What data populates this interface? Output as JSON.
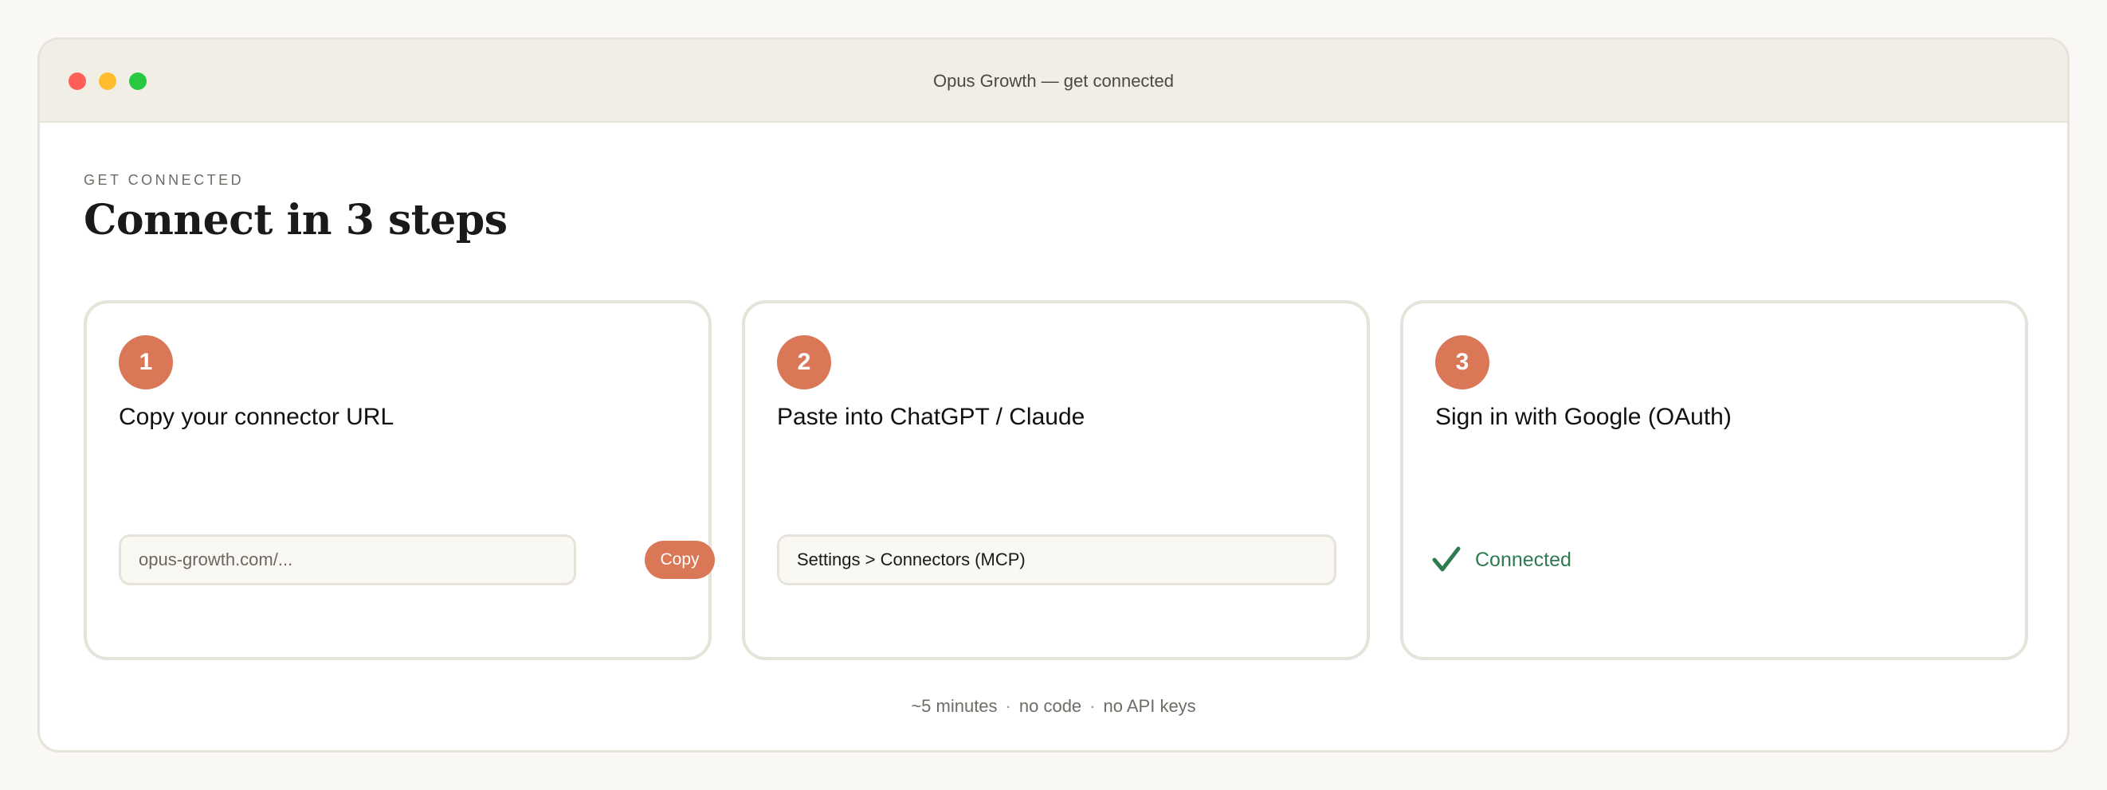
{
  "window": {
    "title": "Opus Growth — get connected"
  },
  "header": {
    "eyebrow": "GET CONNECTED",
    "title": "Connect in 3 steps"
  },
  "steps": [
    {
      "number": "1",
      "title": "Copy your connector URL",
      "field_value": "opus-growth.com/...",
      "button_label": "Copy"
    },
    {
      "number": "2",
      "title": "Paste into ChatGPT / Claude",
      "field_value": "Settings > Connectors (MCP)"
    },
    {
      "number": "3",
      "title": "Sign in with Google (OAuth)",
      "status_label": "Connected",
      "status_icon": "checkmark-icon"
    }
  ],
  "footer": {
    "items": [
      "~5 minutes",
      "no code",
      "no API keys"
    ]
  },
  "colors": {
    "accent": "#d97757",
    "success": "#2f7a4f",
    "window_bg": "#ffffff",
    "titlebar_bg": "#f1eee6"
  }
}
